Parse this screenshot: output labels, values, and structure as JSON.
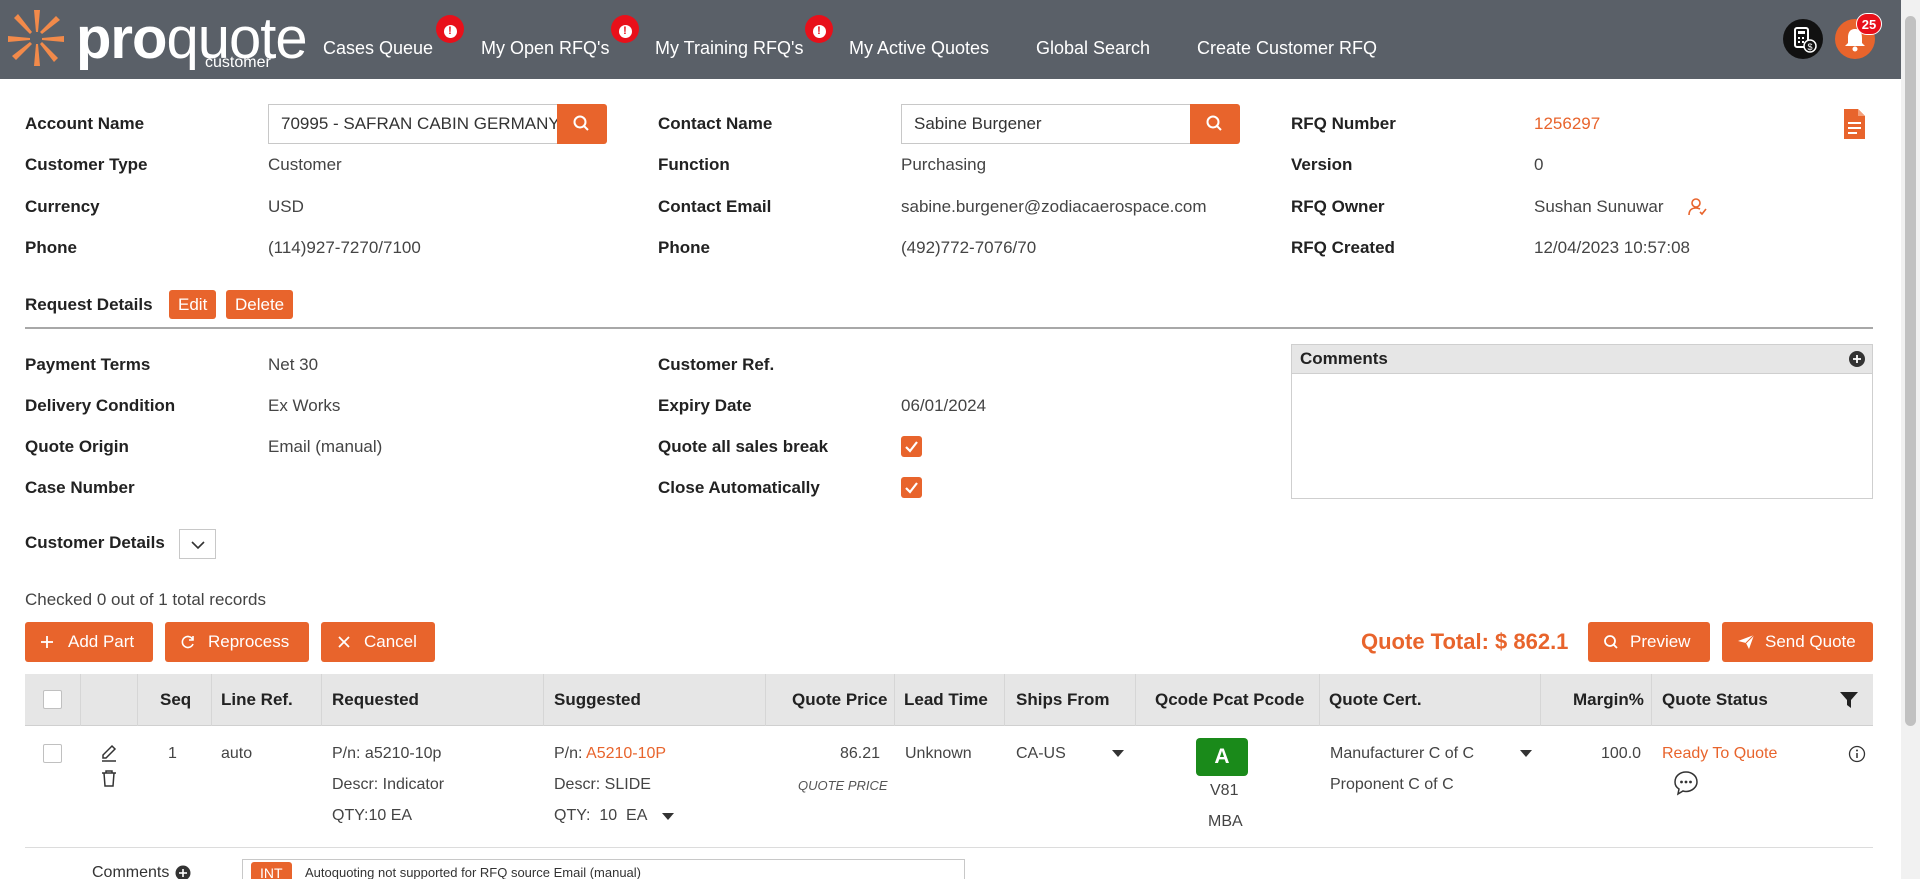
{
  "app": {
    "logo_pro": "pro",
    "logo_quote": "quote",
    "logo_sub": "customer"
  },
  "nav": {
    "items": [
      {
        "label": "Cases Queue",
        "badge": "!"
      },
      {
        "label": "My Open RFQ's",
        "badge": "!"
      },
      {
        "label": "My Training RFQ's",
        "badge": "!"
      },
      {
        "label": "My Active Quotes"
      },
      {
        "label": "Global Search"
      },
      {
        "label": "Create Customer RFQ"
      }
    ],
    "notification_count": "25",
    "calculator_icon": "calculator-dollar-icon",
    "bell_icon": "bell-icon"
  },
  "account": {
    "account_name_label": "Account Name",
    "account_name_value": "70995 - SAFRAN CABIN GERMANY",
    "customer_type_label": "Customer Type",
    "customer_type_value": "Customer",
    "currency_label": "Currency",
    "currency_value": "USD",
    "phone_label": "Phone",
    "phone_value": "(114)927-7270/7100"
  },
  "contact": {
    "contact_name_label": "Contact Name",
    "contact_name_value": "Sabine  Burgener",
    "function_label": "Function",
    "function_value": "Purchasing",
    "email_label": "Contact Email",
    "email_value": "sabine.burgener@zodiacaerospace.com",
    "phone_label": "Phone",
    "phone_value": "(492)772-7076/70"
  },
  "rfq": {
    "number_label": "RFQ Number",
    "number_value": "1256297",
    "version_label": "Version",
    "version_value": "0",
    "owner_label": "RFQ Owner",
    "owner_value": "Sushan Sunuwar",
    "created_label": "RFQ Created",
    "created_value": "12/04/2023 10:57:08"
  },
  "request_details": {
    "title": "Request Details",
    "edit_label": "Edit",
    "delete_label": "Delete",
    "payment_terms_label": "Payment Terms",
    "payment_terms_value": "Net 30",
    "delivery_condition_label": "Delivery Condition",
    "delivery_condition_value": "Ex Works",
    "quote_origin_label": "Quote Origin",
    "quote_origin_value": "Email (manual)",
    "case_number_label": "Case Number",
    "case_number_value": "",
    "customer_ref_label": "Customer Ref.",
    "customer_ref_value": "",
    "expiry_date_label": "Expiry Date",
    "expiry_date_value": "06/01/2024",
    "quote_all_label": "Quote all sales break",
    "quote_all_checked": true,
    "close_auto_label": "Close Automatically",
    "close_auto_checked": true,
    "comments_title": "Comments"
  },
  "customer_details": {
    "title": "Customer Details"
  },
  "records": {
    "summary": "Checked 0 out of 1 total records"
  },
  "actions": {
    "add_part": "Add Part",
    "reprocess": "Reprocess",
    "cancel": "Cancel",
    "quote_total": "Quote Total: $ 862.1",
    "preview": "Preview",
    "send_quote": "Send Quote"
  },
  "table": {
    "headers": {
      "seq": "Seq",
      "line_ref": "Line Ref.",
      "requested": "Requested",
      "suggested": "Suggested",
      "quote_price": "Quote Price",
      "lead_time": "Lead Time",
      "ships_from": "Ships From",
      "qcode": "Qcode Pcat Pcode",
      "quote_cert": "Quote Cert.",
      "margin": "Margin%",
      "quote_status": "Quote Status"
    },
    "rows": [
      {
        "seq": "1",
        "line_ref": "auto",
        "req_pn_label": "P/n:",
        "req_pn": "a5210-10p",
        "req_descr": "Descr: Indicator",
        "req_qty": "QTY:10 EA",
        "sug_pn_label": "P/n:",
        "sug_pn": "A5210-10P",
        "sug_descr": "Descr: SLIDE",
        "sug_qty": "QTY:  10  EA",
        "quote_price": "86.21",
        "quote_price_note": "QUOTE PRICE",
        "lead_time": "Unknown",
        "ships_from": "CA-US",
        "qcode": "A",
        "pcat": "V81",
        "pcode": "MBA",
        "cert_1": "Manufacturer C of C",
        "cert_2": "Proponent C of C",
        "margin": "100.0",
        "status": "Ready To Quote"
      }
    ],
    "comments_label": "Comments",
    "int_tag": "INT",
    "int_note": "Autoquoting not supported for RFQ source Email (manual)"
  },
  "colors": {
    "accent": "#e8642c",
    "nav_bg": "#5a6068",
    "alert": "#e8101a",
    "qcode_green": "#1a8a1a"
  }
}
